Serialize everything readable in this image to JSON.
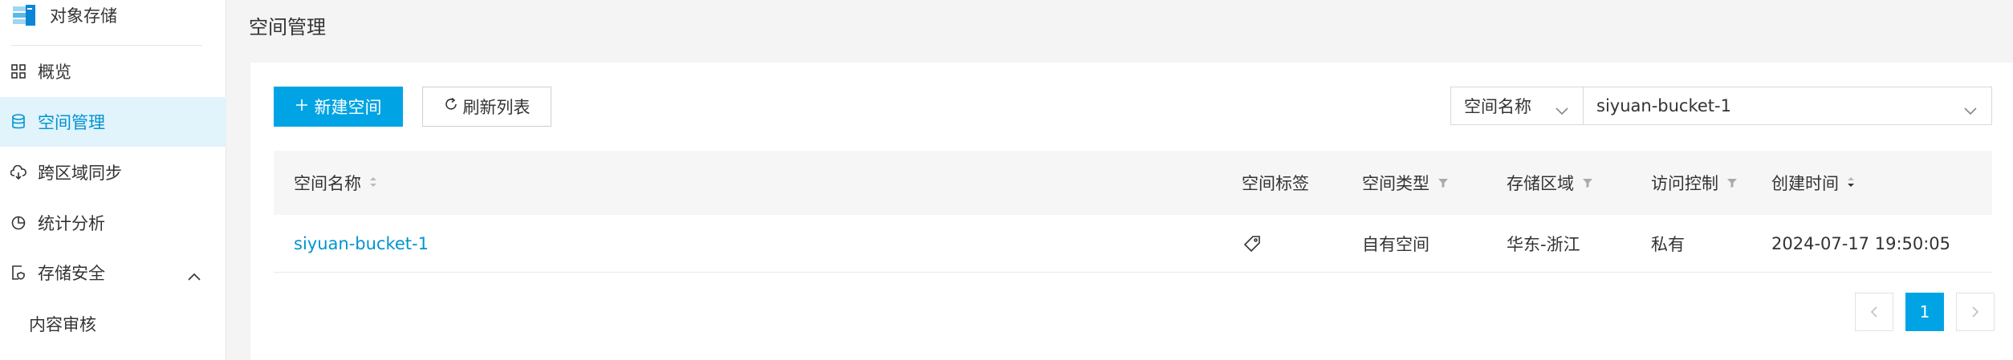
{
  "brand": {
    "title": "对象存储",
    "icon": "object-storage-logo"
  },
  "sidebar": {
    "items": [
      {
        "label": "概览",
        "icon": "grid-icon"
      },
      {
        "label": "空间管理",
        "icon": "database-icon",
        "active": true
      },
      {
        "label": "跨区域同步",
        "icon": "cloud-sync-icon"
      },
      {
        "label": "统计分析",
        "icon": "pie-chart-icon"
      },
      {
        "label": "存储安全",
        "icon": "shield-document-icon",
        "expanded": true
      }
    ],
    "sub_items": [
      {
        "label": "内容审核"
      }
    ]
  },
  "header": {
    "title": "空间管理"
  },
  "toolbar": {
    "new_bucket_label": "新建空间",
    "refresh_label": "刷新列表"
  },
  "filter": {
    "field": "空间名称",
    "value": "siyuan-bucket-1"
  },
  "table": {
    "columns": [
      "空间名称",
      "空间标签",
      "空间类型",
      "存储区域",
      "访问控制",
      "创建时间"
    ],
    "rows": [
      {
        "name": "siyuan-bucket-1",
        "type": "自有空间",
        "region": "华东-浙江",
        "acl": "私有",
        "created": "2024-07-17 19:50:05"
      }
    ]
  },
  "pagination": {
    "current": "1"
  },
  "colors": {
    "accent": "#00a4e4",
    "active_bg": "#e1f3fb",
    "link": "#0094d0"
  }
}
